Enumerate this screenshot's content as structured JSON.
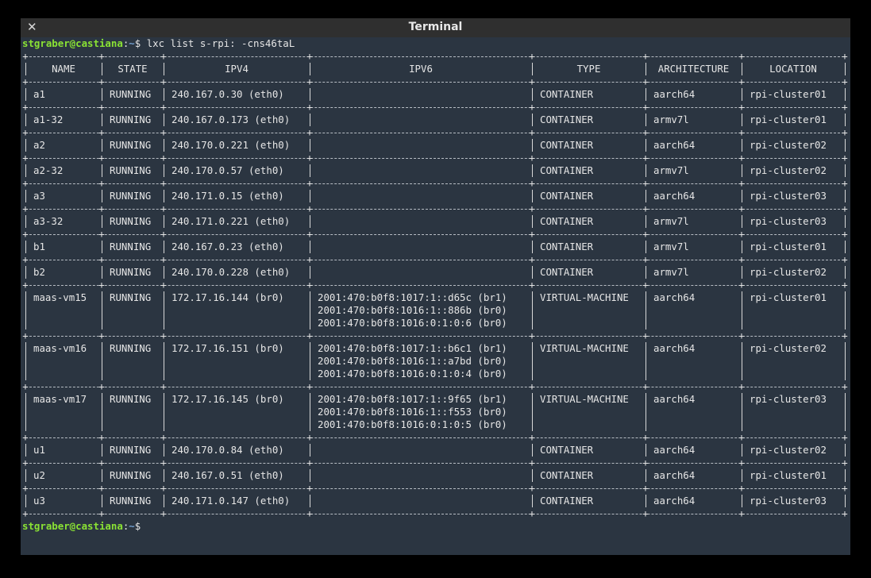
{
  "window": {
    "title": "Terminal"
  },
  "prompt": {
    "user": "stgraber@castiana",
    "path": "~",
    "symbol": "$"
  },
  "command": "lxc list s-rpi: -cns46taL",
  "table": {
    "headers": [
      "NAME",
      "STATE",
      "IPV4",
      "IPV6",
      "TYPE",
      "ARCHITECTURE",
      "LOCATION"
    ],
    "rows": [
      [
        "a1",
        "RUNNING",
        "240.167.0.30 (eth0)",
        "",
        "CONTAINER",
        "aarch64",
        "rpi-cluster01"
      ],
      [
        "a1-32",
        "RUNNING",
        "240.167.0.173 (eth0)",
        "",
        "CONTAINER",
        "armv7l",
        "rpi-cluster01"
      ],
      [
        "a2",
        "RUNNING",
        "240.170.0.221 (eth0)",
        "",
        "CONTAINER",
        "aarch64",
        "rpi-cluster02"
      ],
      [
        "a2-32",
        "RUNNING",
        "240.170.0.57 (eth0)",
        "",
        "CONTAINER",
        "armv7l",
        "rpi-cluster02"
      ],
      [
        "a3",
        "RUNNING",
        "240.171.0.15 (eth0)",
        "",
        "CONTAINER",
        "aarch64",
        "rpi-cluster03"
      ],
      [
        "a3-32",
        "RUNNING",
        "240.171.0.221 (eth0)",
        "",
        "CONTAINER",
        "armv7l",
        "rpi-cluster03"
      ],
      [
        "b1",
        "RUNNING",
        "240.167.0.23 (eth0)",
        "",
        "CONTAINER",
        "armv7l",
        "rpi-cluster01"
      ],
      [
        "b2",
        "RUNNING",
        "240.170.0.228 (eth0)",
        "",
        "CONTAINER",
        "armv7l",
        "rpi-cluster02"
      ],
      [
        "maas-vm15",
        "RUNNING",
        "172.17.16.144 (br0)",
        "2001:470:b0f8:1017:1::d65c (br1)\n2001:470:b0f8:1016:1::886b (br0)\n2001:470:b0f8:1016:0:1:0:6 (br0)",
        "VIRTUAL-MACHINE",
        "aarch64",
        "rpi-cluster01"
      ],
      [
        "maas-vm16",
        "RUNNING",
        "172.17.16.151 (br0)",
        "2001:470:b0f8:1017:1::b6c1 (br1)\n2001:470:b0f8:1016:1::a7bd (br0)\n2001:470:b0f8:1016:0:1:0:4 (br0)",
        "VIRTUAL-MACHINE",
        "aarch64",
        "rpi-cluster02"
      ],
      [
        "maas-vm17",
        "RUNNING",
        "172.17.16.145 (br0)",
        "2001:470:b0f8:1017:1::9f65 (br1)\n2001:470:b0f8:1016:1::f553 (br0)\n2001:470:b0f8:1016:0:1:0:5 (br0)",
        "VIRTUAL-MACHINE",
        "aarch64",
        "rpi-cluster03"
      ],
      [
        "u1",
        "RUNNING",
        "240.170.0.84 (eth0)",
        "",
        "CONTAINER",
        "aarch64",
        "rpi-cluster02"
      ],
      [
        "u2",
        "RUNNING",
        "240.167.0.51 (eth0)",
        "",
        "CONTAINER",
        "aarch64",
        "rpi-cluster01"
      ],
      [
        "u3",
        "RUNNING",
        "240.171.0.147 (eth0)",
        "",
        "CONTAINER",
        "aarch64",
        "rpi-cluster03"
      ]
    ]
  },
  "colors": {
    "background": "#2b3541",
    "user": "#8ae234",
    "path": "#729fcf",
    "titlebar": "#2f2f2f"
  },
  "icons": {
    "close": "close-icon"
  }
}
